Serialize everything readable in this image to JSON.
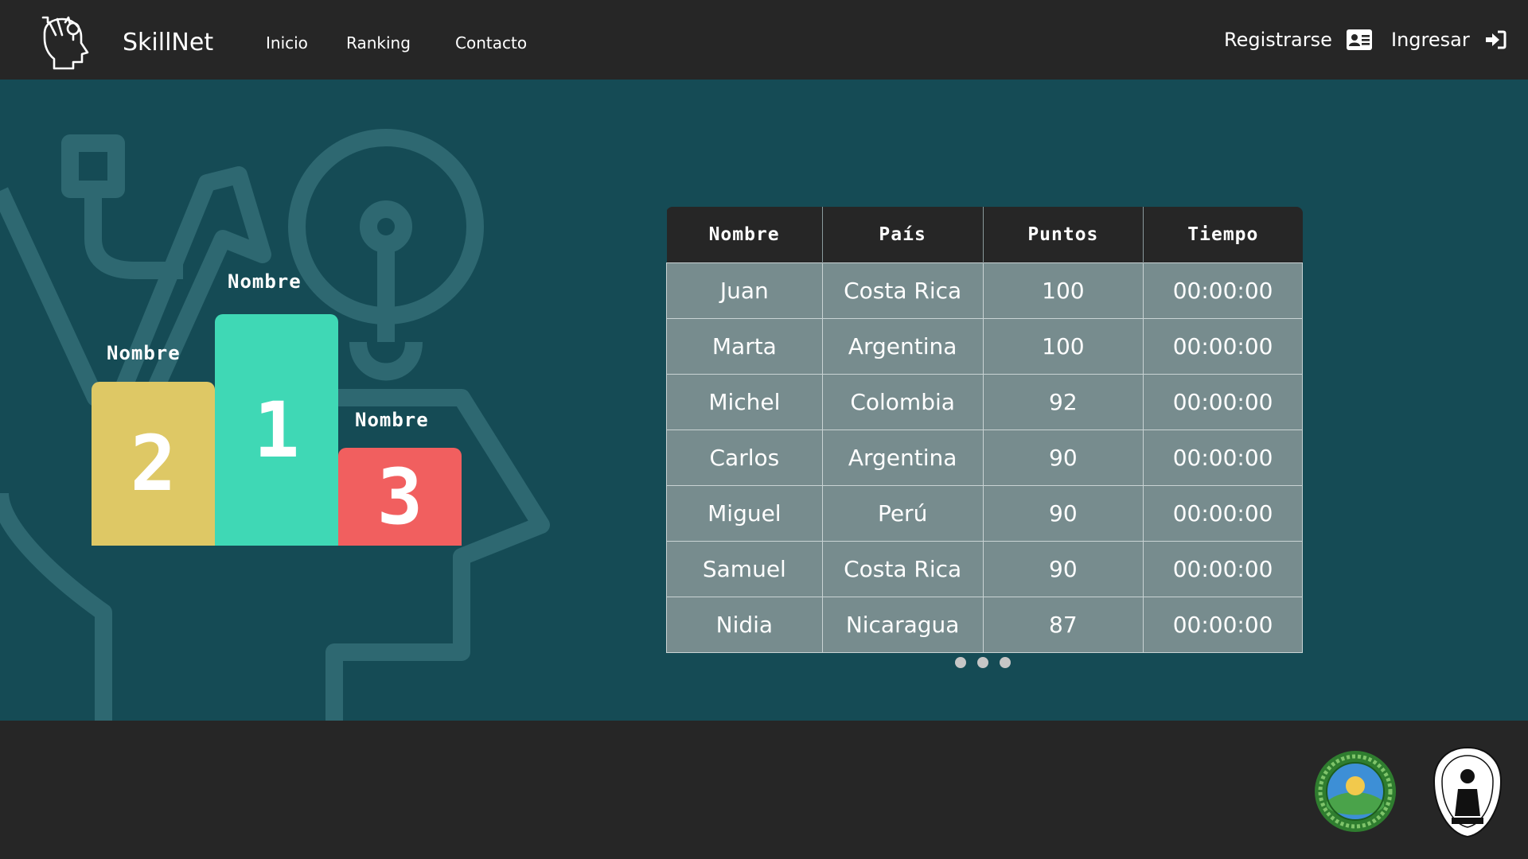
{
  "brand": {
    "name": "SkillNet",
    "logo_icon": "head-lightbulb-icon"
  },
  "nav": {
    "inicio": "Inicio",
    "ranking": "Ranking",
    "contacto": "Contacto"
  },
  "auth": {
    "register_label": "Registrarse",
    "register_icon": "id-card-icon",
    "login_label": "Ingresar",
    "login_icon": "sign-in-icon"
  },
  "podium": {
    "first": {
      "name": "Nombre",
      "place": "1",
      "color": "#3fd8b5"
    },
    "second": {
      "name": "Nombre",
      "place": "2",
      "color": "#dec865"
    },
    "third": {
      "name": "Nombre",
      "place": "3",
      "color": "#f15f5f"
    }
  },
  "table": {
    "headers": [
      "Nombre",
      "País",
      "Puntos",
      "Tiempo"
    ],
    "rows": [
      [
        "Juan",
        "Costa Rica",
        "100",
        "00:00:00"
      ],
      [
        "Marta",
        "Argentina",
        "100",
        "00:00:00"
      ],
      [
        "Michel",
        "Colombia",
        "92",
        "00:00:00"
      ],
      [
        "Carlos",
        "Argentina",
        "90",
        "00:00:00"
      ],
      [
        "Miguel",
        "Perú",
        "90",
        "00:00:00"
      ],
      [
        "Samuel",
        "Costa Rica",
        "90",
        "00:00:00"
      ],
      [
        "Nidia",
        "Nicaragua",
        "87",
        "00:00:00"
      ]
    ]
  },
  "pagination": {
    "pages": 3
  },
  "colors": {
    "header_bg": "#262626",
    "main_bg": "#154b55",
    "table_row_bg": "#778c8e"
  },
  "footer": {
    "seal_1_icon": "municipal-seal-icon",
    "seal_2_icon": "university-seal-icon"
  }
}
